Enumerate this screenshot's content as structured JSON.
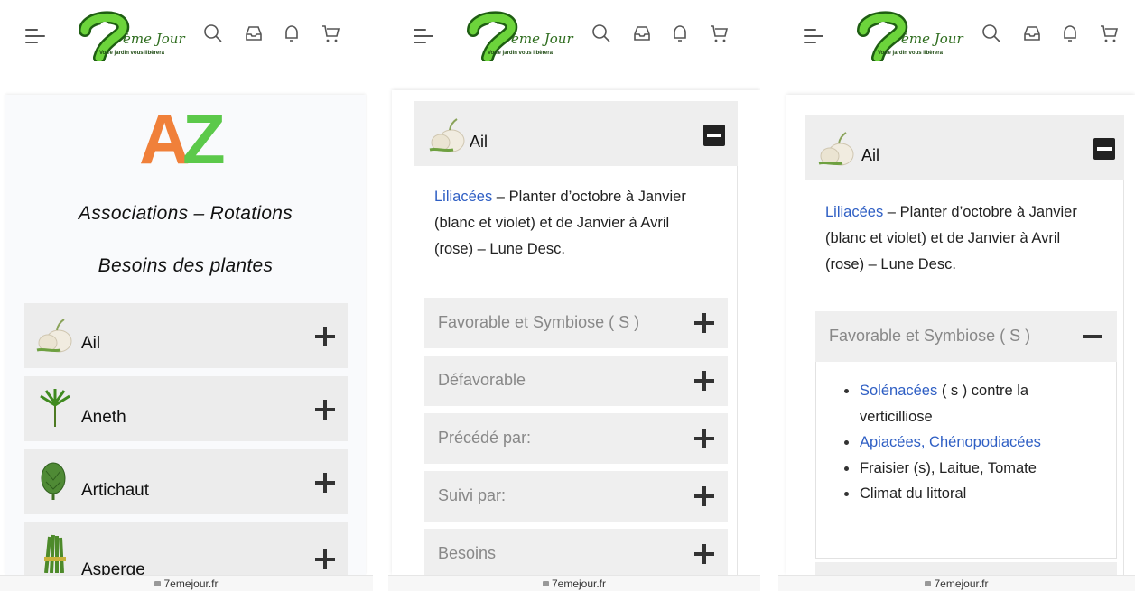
{
  "header": {
    "logo_text": "ème Jour",
    "logo_tagline": "Votre jardin vous libèrera"
  },
  "footer": {
    "url": "7emejour.fr"
  },
  "screen1": {
    "heading_az": "AZ",
    "title_associations": "Associations – Rotations",
    "title_besoins": "Besoins des plantes",
    "plants": [
      {
        "label": "Ail"
      },
      {
        "label": "Aneth"
      },
      {
        "label": "Artichaut"
      },
      {
        "label": "Asperge"
      }
    ]
  },
  "screen2": {
    "accordion_title": "Ail",
    "family_link": "Liliacées",
    "description_line1_rest": " – Planter d’octobre à Janvier",
    "description_line2": "(blanc et violet) et de Janvier à Avril",
    "description_line3": "(rose) – Lune Desc.",
    "sections": [
      {
        "label": "Favorable et Symbiose ( S )"
      },
      {
        "label": "Défavorable"
      },
      {
        "label": "Précédé par:"
      },
      {
        "label": "Suivi par:"
      },
      {
        "label": "Besoins"
      }
    ]
  },
  "screen3": {
    "accordion_title": "Ail",
    "family_link": "Liliacées",
    "description_line1_rest": " – Planter d’octobre à Janvier",
    "description_line2": "(blanc et violet) et de Janvier à Avril",
    "description_line3": "(rose) – Lune Desc.",
    "open_section": "Favorable et Symbiose ( S )",
    "bullets": {
      "b1_link": "Solénacées",
      "b1_rest": " ( s ) contre la",
      "b1_line2": "verticilliose",
      "b2_link": "Apiacées, Chénopodiacées",
      "b3": "Fraisier (s), Laitue, Tomate",
      "b4": "Climat du littoral"
    }
  },
  "colors": {
    "link": "#2f5fc4",
    "az_orange": "#f0803a",
    "az_green": "#5cc94a",
    "accordion_bg": "#eeeeee"
  }
}
